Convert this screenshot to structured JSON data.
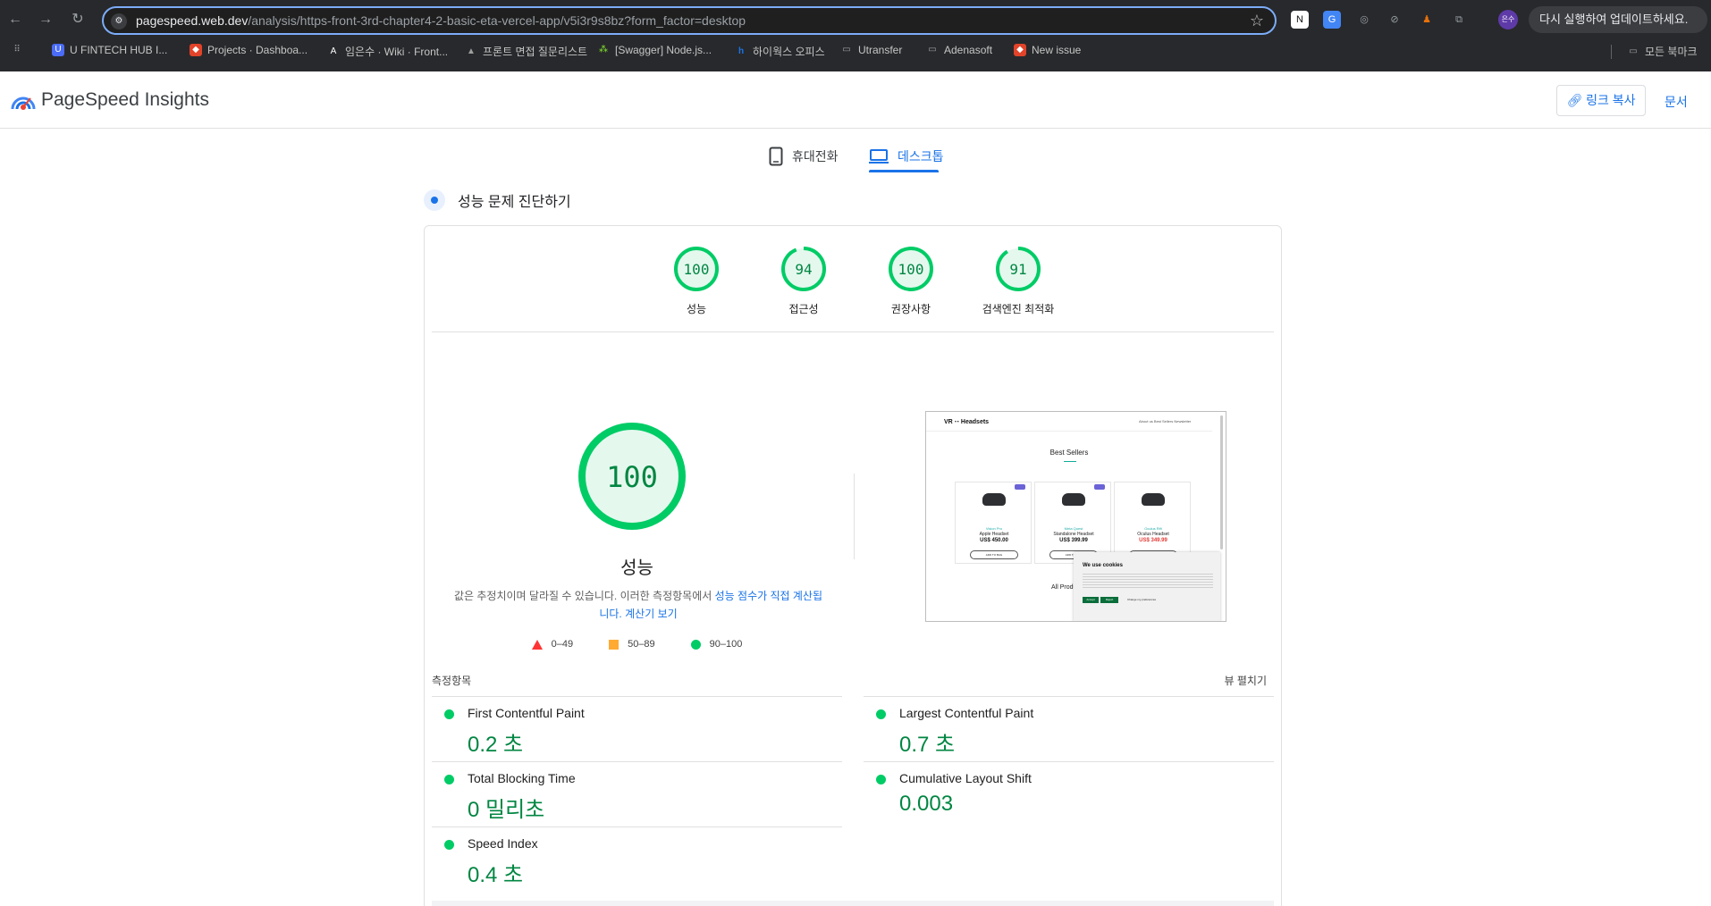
{
  "browser": {
    "url_host": "pagespeed.web.dev",
    "url_path": "/analysis/https-front-3rd-chapter4-2-basic-eta-vercel-app/v5i3r9s8bz?form_factor=desktop",
    "update_button": "다시 실행하여 업데이트하세요.",
    "profile_initials": "은수",
    "bookmarks": [
      {
        "label": "U FINTECH HUB I...",
        "icon_color": "#4a6cf7"
      },
      {
        "label": "Projects · Dashboa...",
        "icon_color": "#e24329"
      },
      {
        "label": "임은수 · Wiki · Front...",
        "icon_color": "#ffffff"
      },
      {
        "label": "프론트 면접 질문리스트",
        "icon_color": "#9e9e9e"
      },
      {
        "label": "[Swagger] Node.js...",
        "icon_color": "#85ea2d"
      },
      {
        "label": "하이웍스 오피스",
        "icon_color": "#1a73e8"
      },
      {
        "label": "Utransfer",
        "icon_color": "folder"
      },
      {
        "label": "Adenasoft",
        "icon_color": "folder"
      },
      {
        "label": "New issue",
        "icon_color": "#e24329"
      }
    ],
    "all_bookmarks": "모든 북마크"
  },
  "header": {
    "title": "PageSpeed Insights",
    "copy_link": "링크 복사",
    "docs": "문서"
  },
  "tabs": {
    "mobile": "휴대전화",
    "desktop": "데스크톱",
    "active": "desktop"
  },
  "diagnose_title": "성능 문제 진단하기",
  "scores": [
    {
      "label": "성능",
      "value": 100
    },
    {
      "label": "접근성",
      "value": 94
    },
    {
      "label": "권장사항",
      "value": 100
    },
    {
      "label": "검색엔진 최적화",
      "value": 91
    }
  ],
  "performance": {
    "score": "100",
    "title": "성능",
    "desc_text": "값은 추정치이며 달라질 수 있습니다. 이러한 측정항목에서 ",
    "desc_link": "성능 점수가 직접 계산됩니다.",
    "calc_link": "계산기 보기"
  },
  "legend": [
    {
      "shape": "triangle",
      "label": "0–49",
      "color": "#ff3333"
    },
    {
      "shape": "square",
      "label": "50–89",
      "color": "#ffaa33"
    },
    {
      "shape": "circle",
      "label": "90–100",
      "color": "#00cc66"
    }
  ],
  "screenshot": {
    "logo": "VR ⋅⋅ Headsets",
    "nav_links": "About us   Best Sellers   Newsletter",
    "heading": "Best Sellers",
    "products": [
      {
        "category": "Vision Pro",
        "name": "Apple Headset",
        "price": "US$ 450.00",
        "button": "ADD TO BAG",
        "price_color": "#111111"
      },
      {
        "category": "Meta Quest",
        "name": "Standalone Headset",
        "price": "US$ 399.99",
        "button": "ADD TO BAG",
        "price_color": "#111111"
      },
      {
        "category": "Oculus Rift",
        "name": "Oculus Headset",
        "price": "US$ 349.99",
        "button": "ADD TO BAG",
        "price_color": "#e53935"
      }
    ],
    "all_products": "All Products",
    "cookie_title": "We use cookies",
    "cookie_accept": "Accept",
    "cookie_reject": "Reject",
    "cookie_prefs": "Change my preferences"
  },
  "metrics_label": "측정항목",
  "expand_view": "뷰 펼치기",
  "metrics": [
    {
      "name": "First Contentful Paint",
      "value": "0.2 초"
    },
    {
      "name": "Largest Contentful Paint",
      "value": "0.7 초"
    },
    {
      "name": "Total Blocking Time",
      "value": "0 밀리초"
    },
    {
      "name": "Cumulative Layout Shift",
      "value": "0.003"
    },
    {
      "name": "Speed Index",
      "value": "0.4 초"
    }
  ],
  "colors": {
    "pass_green": "#0c6",
    "pass_text": "#018642",
    "gauge_fill": "#e5f8ee",
    "accent": "#1a73e8"
  }
}
